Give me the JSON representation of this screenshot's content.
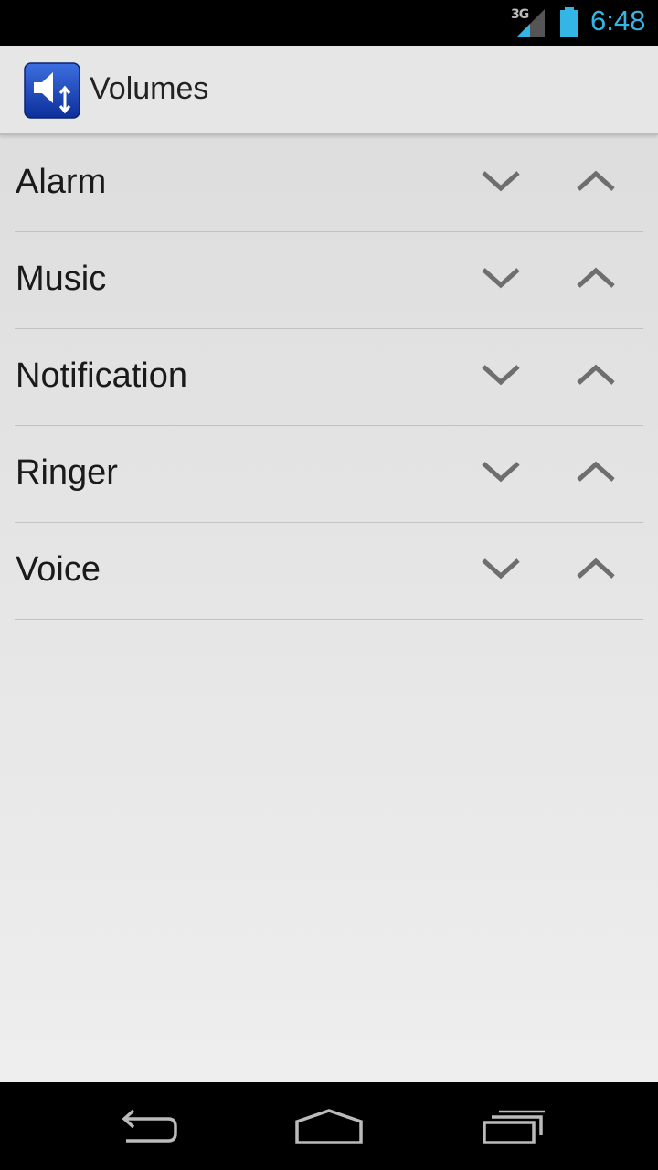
{
  "status_bar": {
    "network": "3G",
    "time": "6:48",
    "accent_color": "#33b5e5"
  },
  "action_bar": {
    "title": "Volumes",
    "icon": "speaker-volume-icon"
  },
  "streams": [
    {
      "label": "Alarm"
    },
    {
      "label": "Music"
    },
    {
      "label": "Notification"
    },
    {
      "label": "Ringer"
    },
    {
      "label": "Voice"
    }
  ],
  "controls": {
    "down_icon": "chevron-down-icon",
    "up_icon": "chevron-up-icon"
  },
  "nav_bar": {
    "icons": [
      "back-icon",
      "home-icon",
      "recents-icon"
    ]
  }
}
